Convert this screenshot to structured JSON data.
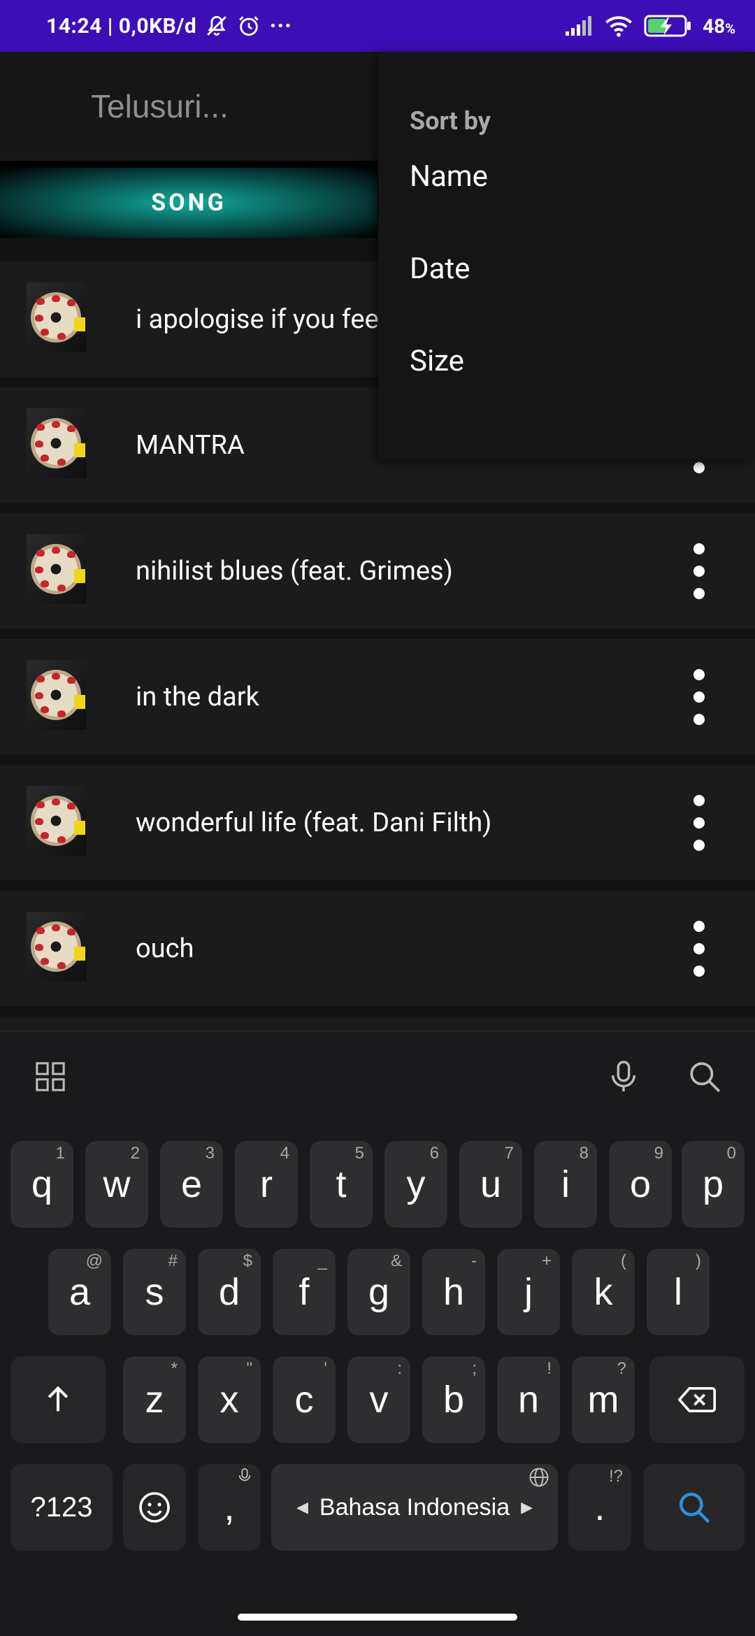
{
  "status_bar": {
    "left_text": "14:24 | 0,0KB/d",
    "battery": "48",
    "battery_unit": "%",
    "more": "···"
  },
  "search": {
    "placeholder": "Telusuri..."
  },
  "tabs": [
    {
      "label": "SONG"
    }
  ],
  "songs": [
    {
      "title": "i apologise if you feel something"
    },
    {
      "title": "MANTRA"
    },
    {
      "title": "nihilist blues (feat. Grimes)"
    },
    {
      "title": "in the dark"
    },
    {
      "title": "wonderful life (feat. Dani Filth)"
    },
    {
      "title": "ouch"
    }
  ],
  "sort_menu": {
    "title": "Sort by",
    "items": [
      "Name",
      "Date",
      "Size"
    ]
  },
  "keyboard": {
    "row1": [
      {
        "key": "q",
        "hint": "1"
      },
      {
        "key": "w",
        "hint": "2"
      },
      {
        "key": "e",
        "hint": "3"
      },
      {
        "key": "r",
        "hint": "4"
      },
      {
        "key": "t",
        "hint": "5"
      },
      {
        "key": "y",
        "hint": "6"
      },
      {
        "key": "u",
        "hint": "7"
      },
      {
        "key": "i",
        "hint": "8"
      },
      {
        "key": "o",
        "hint": "9"
      },
      {
        "key": "p",
        "hint": "0"
      }
    ],
    "row2": [
      {
        "key": "a",
        "hint": "@"
      },
      {
        "key": "s",
        "hint": "#"
      },
      {
        "key": "d",
        "hint": "$"
      },
      {
        "key": "f",
        "hint": "_"
      },
      {
        "key": "g",
        "hint": "&"
      },
      {
        "key": "h",
        "hint": "-"
      },
      {
        "key": "j",
        "hint": "+"
      },
      {
        "key": "k",
        "hint": "("
      },
      {
        "key": "l",
        "hint": ")"
      }
    ],
    "row3": [
      {
        "key": "z",
        "hint": "*"
      },
      {
        "key": "x",
        "hint": "\""
      },
      {
        "key": "c",
        "hint": "'"
      },
      {
        "key": "v",
        "hint": ":"
      },
      {
        "key": "b",
        "hint": ";"
      },
      {
        "key": "n",
        "hint": "!"
      },
      {
        "key": "m",
        "hint": "?"
      }
    ],
    "symbols_label": "?123",
    "comma_label": ",",
    "space_label": "Bahasa Indonesia",
    "period_label": ".",
    "period_hint": "!?"
  }
}
